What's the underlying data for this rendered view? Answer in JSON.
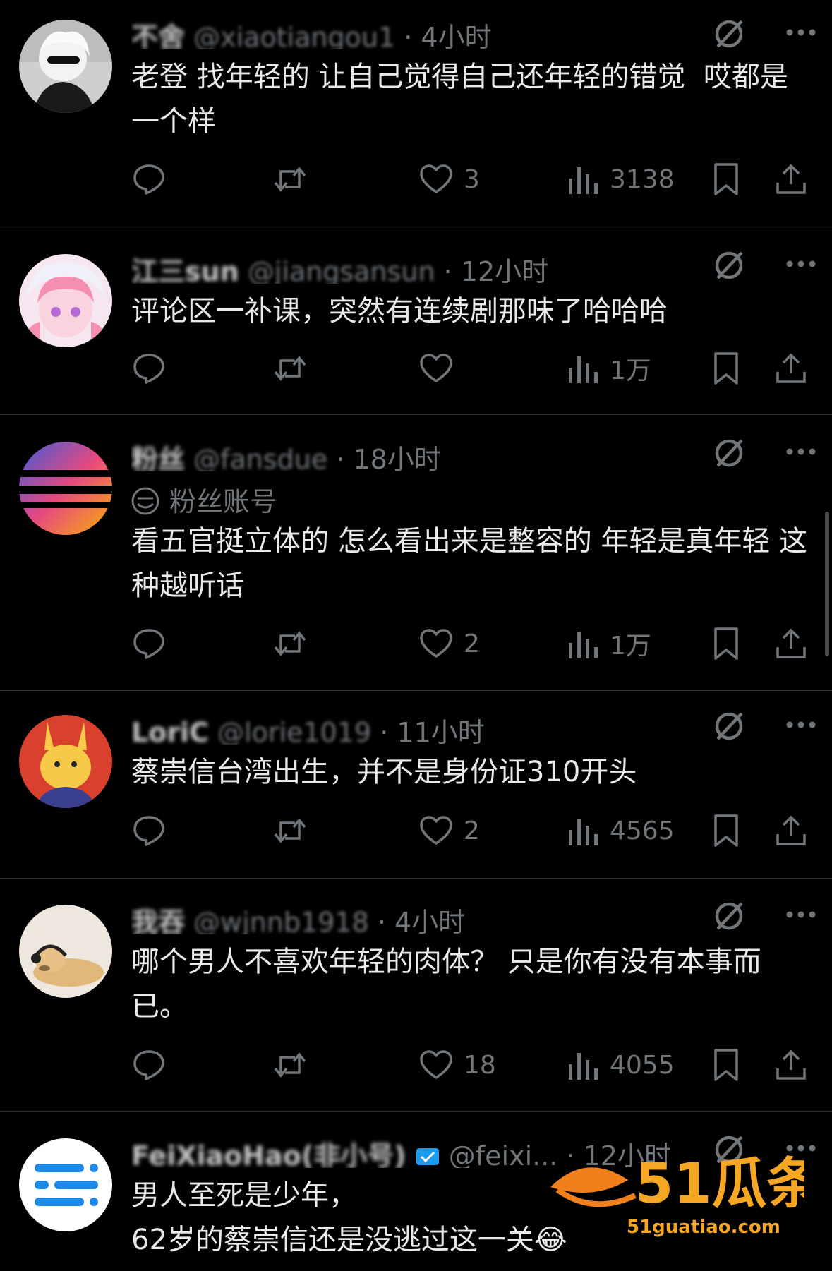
{
  "posts": [
    {
      "name": "不舍",
      "handle": "@xiaotiangou1",
      "time": "· 4小时",
      "text": "老登 找年轻的 让自己觉得自己还年轻的错觉  哎都是一个样",
      "replies": "",
      "reposts": "",
      "likes": "3",
      "views": "3138",
      "avatar": "anime-boy-sunglasses"
    },
    {
      "name": "江三sun",
      "handle": "@jiangsansun",
      "time": "· 12小时",
      "text": "评论区一补课，突然有连续剧那味了哈哈哈",
      "replies": "",
      "reposts": "",
      "likes": "",
      "views": "1万",
      "avatar": "anime-girl-pink"
    },
    {
      "name": "粉丝",
      "handle": "@fansdue",
      "time": "· 18小时",
      "badge": "粉丝账号",
      "text": "看五官挺立体的 怎么看出来是整容的 年轻是真年轻 这种越听话",
      "replies": "",
      "reposts": "",
      "likes": "2",
      "views": "1万",
      "avatar": "gradient-orb"
    },
    {
      "name": "LoriC",
      "handle": "@lorie1019",
      "time": "· 11小时",
      "text": "蔡崇信台湾出生，并不是身份证310开头",
      "replies": "",
      "reposts": "",
      "likes": "2",
      "views": "4565",
      "avatar": "cartoon-rabbit"
    },
    {
      "name": "我吞",
      "handle": "@wjnnb1918",
      "time": "· 4小时",
      "text": "哪个男人不喜欢年轻的肉体？ 只是你有没有本事而已。",
      "replies": "",
      "reposts": "",
      "likes": "18",
      "views": "4055",
      "avatar": "dog-headphones"
    },
    {
      "name": "FeiXiaoHao(非小号)",
      "handle": "@feixi...",
      "time": "· 12小时",
      "text": "男人至死是少年，\n62岁的蔡崇信还是没逃过这一关😂",
      "avatar": "feixiaohao-logo"
    }
  ],
  "watermark": {
    "brand": "51瓜条",
    "url": "51guatiao.com"
  },
  "colors": {
    "background": "#000000",
    "text": "#e7e9ea",
    "muted": "#71767b",
    "divider": "#2f3336",
    "verified": "#1d9bf0"
  }
}
